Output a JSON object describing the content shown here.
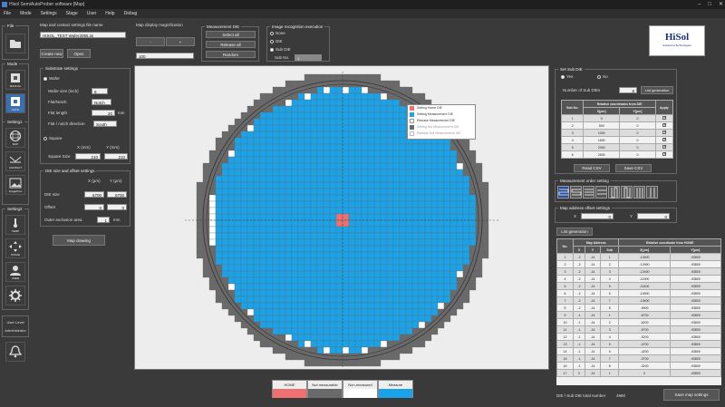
{
  "window": {
    "title": "Hisol SemiAutoProber software [Map]"
  },
  "menu": [
    "File",
    "Mode",
    "Settings",
    "Stage",
    "User",
    "Help",
    "Debug"
  ],
  "sidebar": {
    "file_label": "File",
    "mode_label": "Mode",
    "setting1_label": "Setting1",
    "setting2_label": "Setting2",
    "buttons": [
      {
        "label": "MANUAL"
      },
      {
        "label": "AUTO"
      },
      {
        "label": "MAP"
      },
      {
        "label": "CONTACT"
      },
      {
        "label": "ImageProc"
      },
      {
        "label": "TEMP"
      },
      {
        "label": "STAGE"
      },
      {
        "label": "USER"
      }
    ],
    "user_level_label": "User Level",
    "user_level_value": "Administrator"
  },
  "map_contact": {
    "title": "Map and contact settings file name",
    "file_name": "HISOL_TEST Wafer2055.ini",
    "create_label": "Create new",
    "open_label": "Open"
  },
  "substrate": {
    "title": "Substrate settings",
    "wafer_label": "Wafer",
    "wafer_size_label": "Wafer size (inch)",
    "wafer_size_value": "8",
    "flat_notch_label": "Flat/Notch",
    "flat_notch_value": "Notch",
    "flat_length_label": "Flat length",
    "flat_length_value": "20",
    "flat_length_unit": "mm",
    "direction_label": "Flat / notch direction",
    "direction_value": "South",
    "square_label": "Square",
    "x_mm_label": "X (mm)",
    "y_mm_label": "Y (mm)",
    "square_size_label": "Square Size",
    "square_x": "210",
    "square_y": "210"
  },
  "die_size": {
    "title": "DIE size and offset settings",
    "x_um_label": "X (μm)",
    "y_um_label": "Y (μm)",
    "die_size_label": "DIE size",
    "die_x": "6700",
    "die_y": "6700",
    "offset_label": "Offset",
    "offset_x": "0",
    "offset_y": "0",
    "exclusion_label": "Outer exclusion area",
    "exclusion_value": "1",
    "exclusion_unit": "mm"
  },
  "map_drawing_label": "Map drawing",
  "magnification": {
    "title": "Map display magnification",
    "minus": "-",
    "plus": "+",
    "value": "100"
  },
  "measurement_die": {
    "title": "Measurement DIE",
    "select_all": "Select all",
    "release_all": "Release all",
    "random": "Random"
  },
  "image_recog": {
    "title": "Image recognition execution",
    "none": "None",
    "die": "DIE",
    "sub_die": "Sub DIE",
    "sub_no_label": "Sub No.",
    "sub_no_value": "1"
  },
  "logo": {
    "text": "HiSol",
    "sub": "Advanced Technologies"
  },
  "context_menu": [
    "Setting Home DIE",
    "Setting Measurement DIE",
    "Release Measurement DIE",
    "Setting Not Measurement DIE",
    "Release Not Measurement DIE"
  ],
  "legend": [
    {
      "label": "HOME",
      "color": "#f07070"
    },
    {
      "label": "Not measurable",
      "color": "#6a6a6a"
    },
    {
      "label": "Non-measured",
      "color": "#ffffff"
    },
    {
      "label": "Measure",
      "color": "#1aa3e8"
    }
  ],
  "sub_die": {
    "title": "Set Sub DIE",
    "yes": "Yes",
    "no": "No",
    "count_label": "Number of Sub DIEs",
    "count_value": "8",
    "list_gen": "List generation",
    "headers": {
      "sub_no": "Sub No.",
      "relative": "Relative coordinates from DIE",
      "x": "X[μm]",
      "y": "Y[μm]",
      "apply": "Apply"
    },
    "rows": [
      {
        "no": "1",
        "x": "0",
        "y": "0"
      },
      {
        "no": "2",
        "x": "500",
        "y": "0"
      },
      {
        "no": "3",
        "x": "1000",
        "y": "0"
      },
      {
        "no": "4",
        "x": "1500",
        "y": "0"
      },
      {
        "no": "5",
        "x": "2000",
        "y": "0"
      },
      {
        "no": "6",
        "x": "2500",
        "y": "0"
      }
    ],
    "read_csv": "Read CSV",
    "save_csv": "Save CSV"
  },
  "order": {
    "title": "Measurement order setting"
  },
  "addr_offset": {
    "title": "Map address offset settings",
    "x_label": "X",
    "x_value": "0",
    "y_label": "Y",
    "y_value": "0"
  },
  "list_gen_label": "List generation",
  "map_table": {
    "headers": {
      "no": "No.",
      "map_address": "Map Address",
      "relative": "Relative coordinate from HOME",
      "x": "X",
      "y": "Y",
      "sub": "Sub",
      "xum": "X[μm]",
      "yum": "Y[μm]"
    },
    "rows": [
      {
        "no": "1",
        "x": "-2",
        "y": "-14",
        "sub": "1",
        "xum": "-13400",
        "yum": "-93800"
      },
      {
        "no": "2",
        "x": "-2",
        "y": "-14",
        "sub": "2",
        "xum": "-12900",
        "yum": "-93800"
      },
      {
        "no": "3",
        "x": "-2",
        "y": "-14",
        "sub": "3",
        "xum": "-12400",
        "yum": "-93800"
      },
      {
        "no": "4",
        "x": "-2",
        "y": "-14",
        "sub": "4",
        "xum": "-11900",
        "yum": "-93800"
      },
      {
        "no": "5",
        "x": "-2",
        "y": "-14",
        "sub": "5",
        "xum": "-11400",
        "yum": "-93800"
      },
      {
        "no": "6",
        "x": "-2",
        "y": "-14",
        "sub": "6",
        "xum": "-10900",
        "yum": "-93800"
      },
      {
        "no": "7",
        "x": "-2",
        "y": "-14",
        "sub": "7",
        "xum": "-10400",
        "yum": "-93800"
      },
      {
        "no": "8",
        "x": "-2",
        "y": "-14",
        "sub": "8",
        "xum": "-9900",
        "yum": "-93800"
      },
      {
        "no": "9",
        "x": "-1",
        "y": "-14",
        "sub": "1",
        "xum": "-6700",
        "yum": "-93800"
      },
      {
        "no": "10",
        "x": "-1",
        "y": "-14",
        "sub": "2",
        "xum": "-6200",
        "yum": "-93800"
      },
      {
        "no": "11",
        "x": "-1",
        "y": "-14",
        "sub": "3",
        "xum": "-5700",
        "yum": "-93800"
      },
      {
        "no": "12",
        "x": "-1",
        "y": "-14",
        "sub": "4",
        "xum": "-5200",
        "yum": "-93800"
      },
      {
        "no": "13",
        "x": "-1",
        "y": "-14",
        "sub": "5",
        "xum": "-4700",
        "yum": "-93800"
      },
      {
        "no": "14",
        "x": "-1",
        "y": "-14",
        "sub": "6",
        "xum": "-4200",
        "yum": "-93800"
      },
      {
        "no": "15",
        "x": "-1",
        "y": "-14",
        "sub": "7",
        "xum": "-3700",
        "yum": "-93800"
      },
      {
        "no": "16",
        "x": "-1",
        "y": "-14",
        "sub": "8",
        "xum": "-3200",
        "yum": "-93800"
      },
      {
        "no": "17",
        "x": "0",
        "y": "-14",
        "sub": "1",
        "xum": "0",
        "yum": "-93800"
      }
    ]
  },
  "total": {
    "label": "DIE / Sub DIE total number",
    "value": "4960"
  },
  "save_map_label": "Save map settings"
}
